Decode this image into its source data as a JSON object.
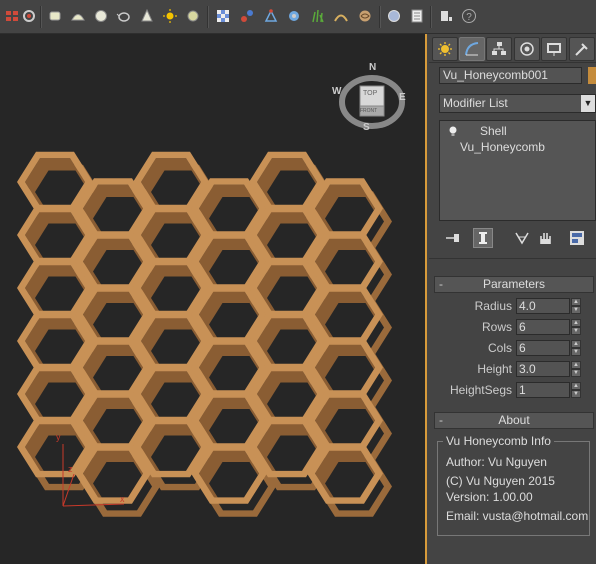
{
  "toolbar": {
    "icons": [
      "standard-primitives-icon",
      "cube-icon",
      "sphere-icon",
      "cylinder-icon",
      "teapot-icon",
      "cone-icon",
      "light-icon",
      "circle-icon",
      "checker-icon",
      "link-icon",
      "bind-icon",
      "particles-icon",
      "grass-icon",
      "rope-icon",
      "shell-icon",
      "globe-icon",
      "document-icon",
      "render-frame-icon",
      "help-icon"
    ]
  },
  "viewport": {
    "viewcube": {
      "top_face": "TOP",
      "bottom_face": "FRONT",
      "north": "N",
      "south": "S",
      "east": "E",
      "west": "W"
    },
    "axis": {
      "x": "x",
      "y": "y",
      "z": "z"
    },
    "colors": {
      "honeycomb_face": "#c89156",
      "honeycomb_side": "#9a6a3b",
      "background": "#262626"
    },
    "honeycomb": {
      "rows": 6,
      "cols": 6
    }
  },
  "command_panel": {
    "tabs": [
      "create-tab",
      "modify-tab",
      "hierarchy-tab",
      "motion-tab",
      "display-tab",
      "utilities-tab"
    ],
    "object_name": "Vu_Honeycomb001",
    "object_color": "#c58c3c",
    "modifier_list_label": "Modifier List",
    "stack": [
      {
        "label": "Shell",
        "selected": false,
        "has_bulb": true
      },
      {
        "label": "Vu_Honeycomb",
        "selected": false,
        "has_bulb": false
      }
    ],
    "parameters": {
      "title": "Parameters",
      "rows": [
        {
          "label": "Radius",
          "value": "4.0"
        },
        {
          "label": "Rows",
          "value": "6"
        },
        {
          "label": "Cols",
          "value": "6"
        },
        {
          "label": "Height",
          "value": "3.0"
        },
        {
          "label": "HeightSegs",
          "value": "1"
        }
      ]
    },
    "about": {
      "title": "About",
      "group_title": "Vu Honeycomb Info",
      "lines": [
        "Author: Vu Nguyen",
        "(C) Vu Nguyen 2015",
        "Version: 1.00.00",
        "Email: vusta@hotmail.com"
      ]
    }
  }
}
